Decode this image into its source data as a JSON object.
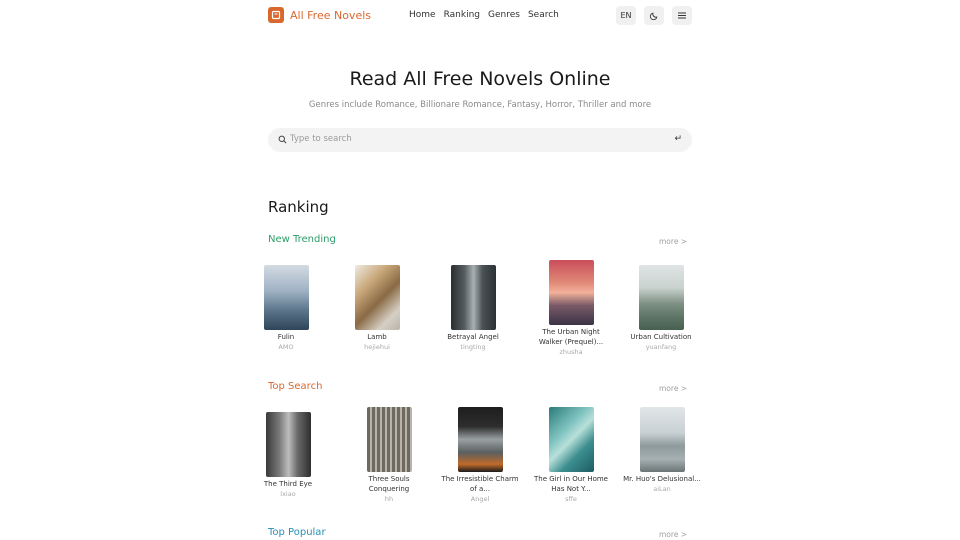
{
  "header": {
    "brand": "All Free Novels",
    "nav": [
      "Home",
      "Ranking",
      "Genres",
      "Search"
    ],
    "lang_button": "EN",
    "theme_icon": "moon-icon",
    "menu_icon": "hamburger-icon"
  },
  "hero": {
    "title": "Read All Free Novels Online",
    "subtitle": "Genres include Romance, Billionare Romance, Fantasy, Horror, Thriller and more",
    "search_placeholder": "Type to search",
    "enter_glyph": "↵"
  },
  "ranking": {
    "title": "Ranking",
    "more_label": "more >",
    "categories": [
      {
        "title": "New Trending",
        "color": "#2e9e6a",
        "books": [
          {
            "title": "Fulin",
            "author": "AMO"
          },
          {
            "title": "Lamb",
            "author": "hejiehui"
          },
          {
            "title": "Betrayal Angel",
            "author": "tingting"
          },
          {
            "title": "The Urban Night Walker (Prequel)...",
            "author": "zhusha"
          },
          {
            "title": "Urban Cultivation",
            "author": "yuanfang"
          }
        ]
      },
      {
        "title": "Top Search",
        "color": "#d9682f",
        "books": [
          {
            "title": "The Third Eye",
            "author": "lxiao"
          },
          {
            "title": "Three Souls Conquering",
            "author": "hh"
          },
          {
            "title": "The Irresistible Charm of a...",
            "author": "Angel"
          },
          {
            "title": "The Girl in Our Home Has Not Y...",
            "author": "sffe"
          },
          {
            "title": "Mr. Huo's Delusional...",
            "author": "aiLan"
          }
        ]
      },
      {
        "title": "Top Popular",
        "color": "#2a8fb0",
        "books": []
      }
    ]
  }
}
